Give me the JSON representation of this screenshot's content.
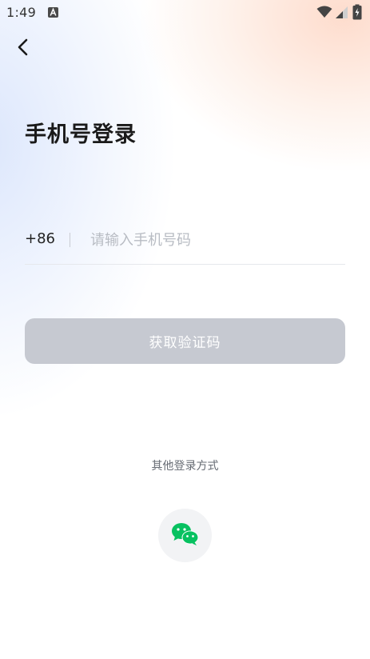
{
  "status_bar": {
    "time": "1:49",
    "icons": [
      "a-notification-icon",
      "wifi-icon",
      "signal-icon",
      "battery-charging-icon"
    ]
  },
  "header": {
    "back_icon": "chevron-left-icon"
  },
  "title": "手机号登录",
  "phone_form": {
    "country_code": "+86",
    "phone_value": "",
    "phone_placeholder": "请输入手机号码"
  },
  "primary_button": {
    "label": "获取验证码",
    "state": "disabled"
  },
  "other_login": {
    "label": "其他登录方式",
    "options": [
      {
        "icon": "wechat-icon",
        "brand_color": "#07C160"
      }
    ]
  },
  "colors": {
    "button_disabled": "#C6C9D1",
    "title_text": "#1A1A1A",
    "placeholder": "#B8BCC3",
    "wechat_green": "#07C160"
  }
}
